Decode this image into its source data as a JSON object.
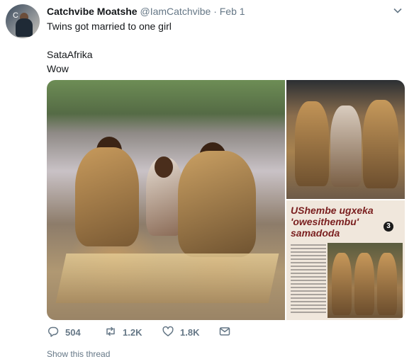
{
  "tweet": {
    "display_name": "Catchvibe Moatshe",
    "handle": "@IamCatchvibe",
    "separator": "·",
    "date": "Feb 1",
    "avatar_letter": "C",
    "lines": [
      "Twins got married to one girl",
      "",
      "SataAfrika",
      "Wow"
    ],
    "menu_icon": "chevron-down-icon"
  },
  "media": {
    "magazine_headline": "UShembe ugxeka 'owesithembu' samadoda",
    "magazine_number": "3"
  },
  "actions": {
    "reply_count": "504",
    "retweet_count": "1.2K",
    "like_count": "1.8K",
    "reply_icon": "reply-icon",
    "retweet_icon": "retweet-icon",
    "like_icon": "heart-icon",
    "dm_icon": "envelope-icon"
  },
  "footer": {
    "show_thread": "Show this thread"
  }
}
